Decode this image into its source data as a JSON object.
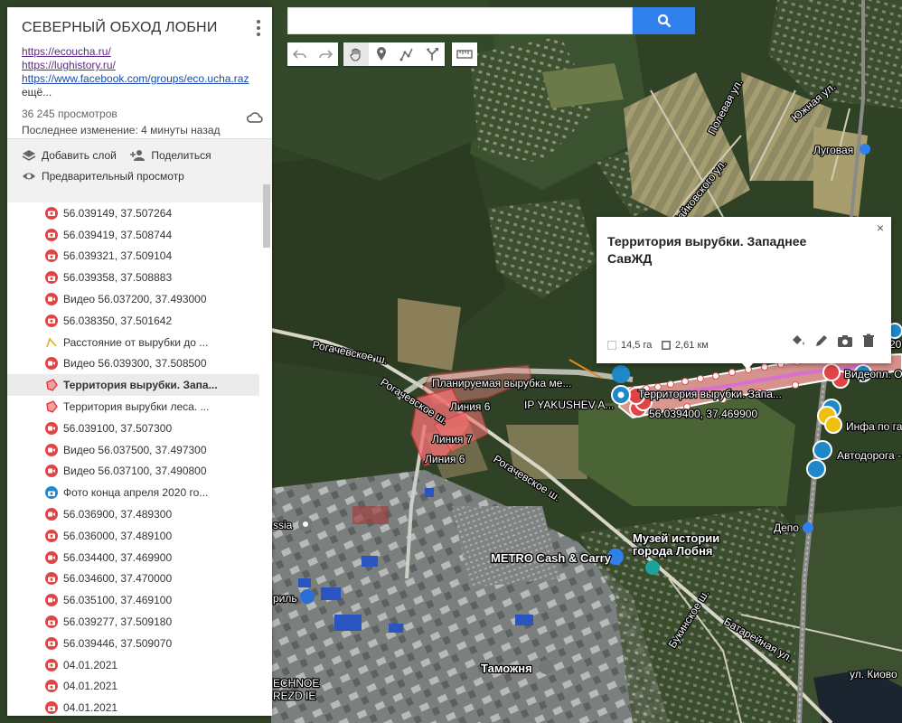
{
  "panel": {
    "title": "СЕВЕРНЫЙ ОБХОД ЛОБНИ",
    "links": [
      "https://ecoucha.ru/",
      "https://lughistory.ru/",
      "https://www.facebook.com/groups/eco.ucha.raz"
    ],
    "more": "ещё...",
    "views": "36 245 просмотров",
    "modified": "Последнее изменение: 4 минуты назад",
    "add_layer": "Добавить слой",
    "share": "Поделиться",
    "preview": "Предварительный просмотр"
  },
  "list": [
    {
      "icon": "camera-red",
      "label": "56.039149, 37.507264"
    },
    {
      "icon": "camera-red",
      "label": "56.039419, 37.508744"
    },
    {
      "icon": "camera-red",
      "label": "56.039321, 37.509104"
    },
    {
      "icon": "camera-red",
      "label": "56.039358, 37.508883"
    },
    {
      "icon": "video-red",
      "label": "Видео 56.037200, 37.493000"
    },
    {
      "icon": "camera-red",
      "label": "56.038350, 37.501642"
    },
    {
      "icon": "line",
      "label": "Расстояние от вырубки до ..."
    },
    {
      "icon": "video-red",
      "label": "Видео 56.039300, 37.508500"
    },
    {
      "icon": "polygon",
      "label": "Территория вырубки. Запа...",
      "selected": true
    },
    {
      "icon": "polygon",
      "label": "Территория вырубки леса. ..."
    },
    {
      "icon": "video-red",
      "label": "56.039100, 37.507300"
    },
    {
      "icon": "video-red",
      "label": "Видео 56.037500, 37.497300"
    },
    {
      "icon": "video-red",
      "label": "Видео 56.037100, 37.490800"
    },
    {
      "icon": "camera-blue",
      "label": "Фото конца апреля 2020 го..."
    },
    {
      "icon": "video-red",
      "label": "56.036900, 37.489300"
    },
    {
      "icon": "camera-red",
      "label": "56.036000, 37.489100"
    },
    {
      "icon": "video-red",
      "label": "56.034400, 37.469900"
    },
    {
      "icon": "camera-red",
      "label": "56.034600, 37.470000"
    },
    {
      "icon": "video-red",
      "label": "56.035100, 37.469100"
    },
    {
      "icon": "camera-red",
      "label": "56.039277, 37.509180"
    },
    {
      "icon": "camera-red",
      "label": "56.039446, 37.509070"
    },
    {
      "icon": "camera-red",
      "label": "04.01.2021"
    },
    {
      "icon": "camera-red",
      "label": "04.01.2021"
    },
    {
      "icon": "camera-red",
      "label": "04.01.2021"
    }
  ],
  "search": {
    "value": "",
    "placeholder": ""
  },
  "card": {
    "title": "Территория вырубки. Западнее СавЖД",
    "area": "14,5 га",
    "length": "2,61 км",
    "close": "×"
  },
  "map_labels": {
    "lugovaya": "Луговая",
    "polevaya": "Полевая ул.",
    "yuzhnaya": "Южная ул.",
    "chaikovskogo": "Чайковского ул.",
    "rogachevskoe1": "Рогачевское ш.",
    "rogachevskoe2": "Рогачевское ш.",
    "rogachevskoe3": "Рогачевское ш.",
    "planned": "Планируемая вырубка ме...",
    "liniya6a": "Линия 6",
    "liniya7": "Линия 7",
    "liniya6b": "Линия 6",
    "yakushev": "IP YAKUSHEV A...",
    "territory": "Территория вырубки. Запа...",
    "coord": "56.039400, 37.469900",
    "video_right": "Видеопл. От...",
    "info_gas": "Инфа по газ...",
    "avtodoroga": "Автодорога - ...",
    "depo": "Депо",
    "museum1": "Музей истории",
    "museum2": "города Лобня",
    "metro": "METRO Cash & Carry",
    "tamozhnya": "Таможня",
    "russia": "ssia",
    "ril": "риль",
    "technoe1": "ECHNOE",
    "technoe2": "REZD IE",
    "bukinskoe": "Букинское ш.",
    "batareinaya": "Батарейная ул.",
    "kivo": "ул. Киово",
    "rp": "20"
  },
  "colors": {
    "accent": "#2f80ed",
    "marker_red": "#e04444",
    "marker_blue": "#1e88c9",
    "polygon_fill": "#f08a8a",
    "polygon_stroke": "#e03030"
  }
}
